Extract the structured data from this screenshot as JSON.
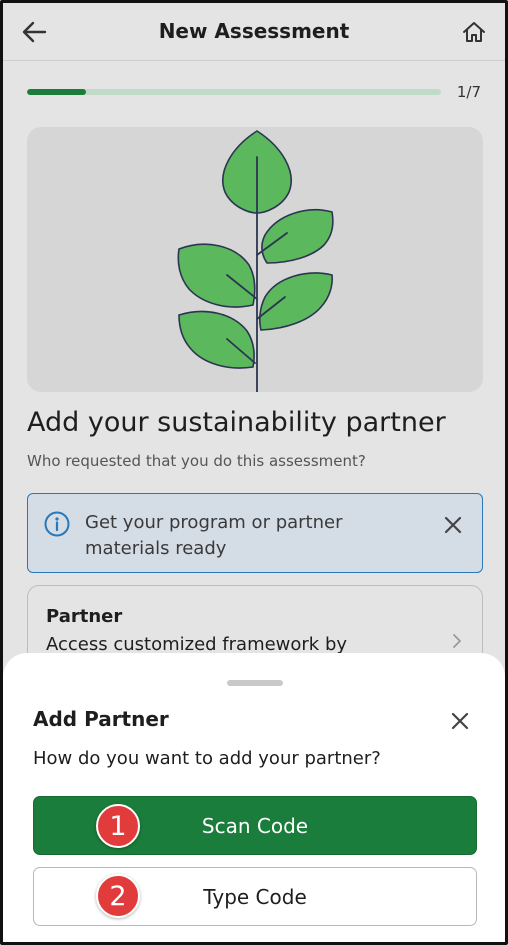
{
  "header": {
    "title": "New Assessment",
    "back_icon": "arrow-left-icon",
    "home_icon": "home-icon"
  },
  "progress": {
    "current": 1,
    "total": 7,
    "label": "1/7"
  },
  "main": {
    "heading": "Add your sustainability partner",
    "subheading": "Who requested that you do this assessment?"
  },
  "info_banner": {
    "text": "Get your program or partner materials ready",
    "icon": "info-icon"
  },
  "partner_card": {
    "title": "Partner",
    "description": "Access customized framework by"
  },
  "sheet": {
    "title": "Add Partner",
    "question": "How do you want to add your partner?",
    "scan_label": "Scan Code",
    "type_label": "Type Code"
  },
  "badges": {
    "one": "1",
    "two": "2"
  },
  "colors": {
    "primary_green": "#1b7d3b",
    "progress_track": "#c2dbc9",
    "info_blue": "#2a78b7",
    "badge_red": "#e13b3b",
    "leaf_green": "#5cb85c"
  }
}
